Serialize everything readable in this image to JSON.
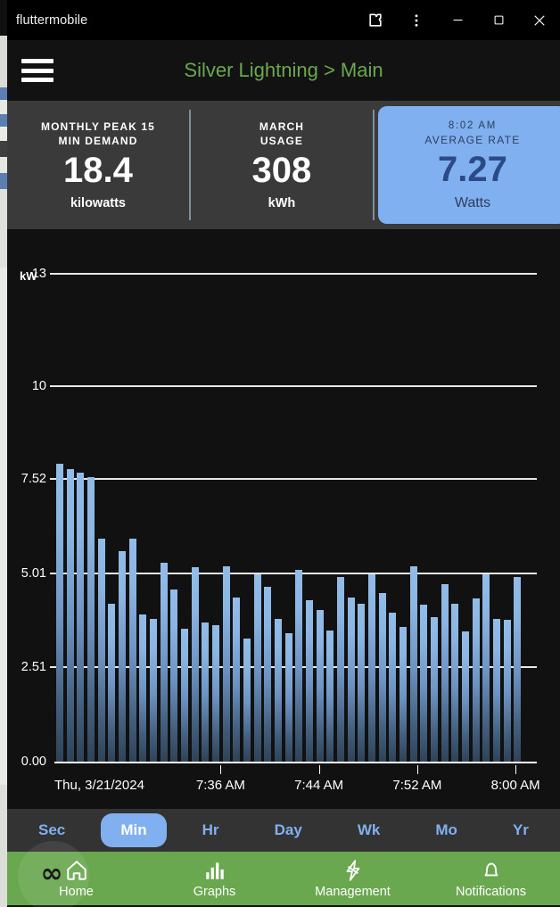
{
  "window": {
    "title": "fluttermobile",
    "titlebar_icons": [
      "extensions-puzzle-icon",
      "more-vertical-icon"
    ],
    "controls": {
      "minimize": "–",
      "maximize": "□",
      "close": "✕"
    }
  },
  "appbar": {
    "menu_icon": "hamburger-menu-icon",
    "title": "Silver Lightning > Main",
    "title_color": "#6aa84f"
  },
  "stats": [
    {
      "caption_line1": "MONTHLY PEAK 15",
      "caption_line2": "MIN DEMAND",
      "value": "18.4",
      "unit": "kilowatts",
      "accent": false
    },
    {
      "caption_line1": "MARCH",
      "caption_line2": "USAGE",
      "value": "308",
      "unit": "kWh",
      "accent": false
    },
    {
      "caption_line1": "8:02 AM",
      "caption_line2": "AVERAGE RATE",
      "value": "7.27",
      "unit": "Watts",
      "accent": true,
      "accent_color": "#81b0f0"
    }
  ],
  "chart_data": {
    "type": "bar",
    "title": "",
    "unit_label": "kW",
    "ylabel": "kW",
    "xlabel": "",
    "ylim": [
      0,
      14.2
    ],
    "grid": true,
    "legend": false,
    "yticks": [
      0.0,
      2.51,
      5.01,
      7.52,
      10,
      13
    ],
    "ytick_labels": [
      "0.00",
      "2.51",
      "5.01",
      "7.52",
      "10",
      "13"
    ],
    "xtick_labels": [
      "Thu, 3/21/2024",
      "7:36 AM",
      "7:44 AM",
      "7:52 AM",
      "8:00 AM"
    ],
    "xtick_positions": [
      0,
      0.355,
      0.565,
      0.775,
      0.985
    ],
    "bar_color_top": "#93bde8",
    "bar_color_bottom": "#2e4257",
    "values": [
      7.95,
      7.82,
      7.72,
      7.6,
      5.95,
      4.22,
      5.63,
      5.97,
      3.95,
      3.82,
      5.32,
      4.6,
      3.57,
      5.2,
      3.73,
      3.66,
      5.22,
      4.4,
      3.3,
      5.02,
      4.68,
      3.82,
      3.45,
      5.12,
      4.33,
      4.07,
      3.52,
      4.93,
      4.39,
      4.23,
      5.01,
      4.52,
      4.0,
      3.62,
      5.22,
      4.2,
      3.86,
      4.76,
      4.22,
      3.5,
      4.38,
      5.0,
      3.82,
      3.8,
      4.93
    ]
  },
  "periods": {
    "items": [
      {
        "label": "Sec",
        "active": false
      },
      {
        "label": "Min",
        "active": true
      },
      {
        "label": "Hr",
        "active": false
      },
      {
        "label": "Day",
        "active": false
      },
      {
        "label": "Wk",
        "active": false
      },
      {
        "label": "Mo",
        "active": false
      },
      {
        "label": "Yr",
        "active": false
      }
    ],
    "active_color": "#81b0f0"
  },
  "bottomnav": {
    "bg_color": "#6aa84f",
    "items": [
      {
        "label": "Home",
        "icon": "home-icon"
      },
      {
        "label": "Graphs",
        "icon": "bar-chart-icon"
      },
      {
        "label": "Management",
        "icon": "lightning-bolt-icon"
      },
      {
        "label": "Notifications",
        "icon": "bell-icon"
      }
    ],
    "overlay_glyph": "∞"
  }
}
